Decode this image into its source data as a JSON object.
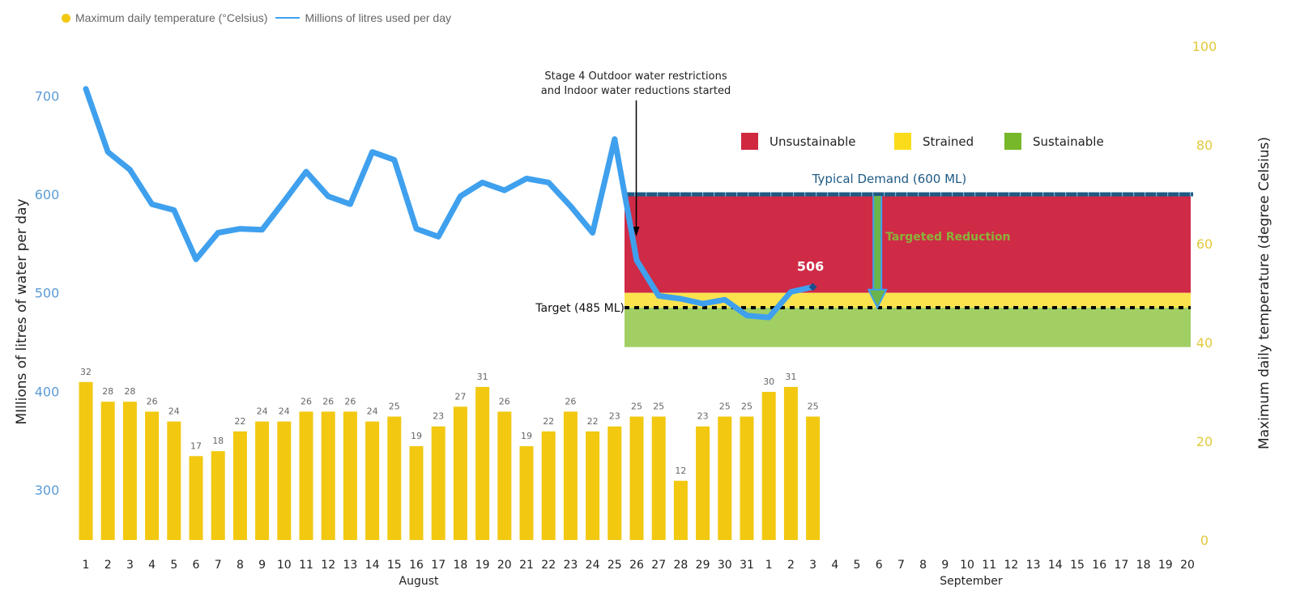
{
  "legend": {
    "temp_label": "Maximum daily temperature (°Celsius)",
    "usage_label": "Millions of litres used per day",
    "temp_color": "#F2C811",
    "usage_color": "#3FA0EE"
  },
  "annotations": {
    "stage4_line1": "Stage 4 Outdoor water restrictions",
    "stage4_line2": "and Indoor water reductions started",
    "typical_demand": "Typical Demand (600 ML)",
    "target": "Target (485 ML)",
    "targeted_reduction": "Targeted Reduction",
    "last_value": "506"
  },
  "zone_legend": [
    {
      "label": "Unsustainable",
      "color": "#D0283F"
    },
    {
      "label": "Strained",
      "color": "#FADC1C"
    },
    {
      "label": "Sustainable",
      "color": "#76B82A"
    }
  ],
  "chart_data": {
    "type": "bar+line",
    "title": "",
    "xlabel_groups": [
      "August",
      "September"
    ],
    "categories": [
      "1",
      "2",
      "3",
      "4",
      "5",
      "6",
      "7",
      "8",
      "9",
      "10",
      "11",
      "12",
      "13",
      "14",
      "15",
      "16",
      "17",
      "18",
      "19",
      "20",
      "21",
      "22",
      "23",
      "24",
      "25",
      "26",
      "27",
      "28",
      "29",
      "30",
      "31",
      "1",
      "2",
      "3",
      "4",
      "5",
      "6",
      "7",
      "8",
      "9",
      "10",
      "11",
      "12",
      "13",
      "14",
      "15",
      "16",
      "17",
      "18",
      "19",
      "20"
    ],
    "category_months": [
      "August",
      "August",
      "August",
      "August",
      "August",
      "August",
      "August",
      "August",
      "August",
      "August",
      "August",
      "August",
      "August",
      "August",
      "August",
      "August",
      "August",
      "August",
      "August",
      "August",
      "August",
      "August",
      "August",
      "August",
      "August",
      "August",
      "August",
      "August",
      "August",
      "August",
      "August",
      "September",
      "September",
      "September",
      "September",
      "September",
      "September",
      "September",
      "September",
      "September",
      "September",
      "September",
      "September",
      "September",
      "September",
      "September",
      "September",
      "September",
      "September",
      "September",
      "September"
    ],
    "ylabel_left": "MIllions of litres of water per day",
    "ylabel_right": "Maximum daily temperature (degree Celsius)",
    "ylim_left": [
      250,
      720
    ],
    "yticks_left": [
      300,
      400,
      500,
      600,
      700
    ],
    "ylim_right": [
      0,
      100
    ],
    "yticks_right": [
      0,
      20,
      40,
      60,
      80,
      100
    ],
    "grid": false,
    "legend_position": "top-left",
    "series": [
      {
        "name": "Maximum daily temperature (°Celsius)",
        "type": "bar",
        "axis": "right",
        "values": [
          32,
          28,
          28,
          26,
          24,
          17,
          18,
          22,
          24,
          24,
          26,
          26,
          26,
          24,
          25,
          19,
          23,
          27,
          31,
          26,
          19,
          22,
          26,
          22,
          23,
          25,
          25,
          12,
          23,
          25,
          25,
          30,
          31,
          25
        ]
      },
      {
        "name": "Millions of litres used per day",
        "type": "line",
        "axis": "left",
        "values": [
          707,
          643,
          625,
          590,
          584,
          534,
          561,
          565,
          564,
          593,
          623,
          598,
          590,
          643,
          635,
          565,
          557,
          598,
          612,
          604,
          616,
          612,
          588,
          561,
          656,
          533,
          497,
          494,
          489,
          493,
          477,
          475,
          501,
          506
        ]
      }
    ],
    "zones": [
      {
        "name": "Unsustainable",
        "from": 500,
        "to": 600,
        "start_index": 25
      },
      {
        "name": "Strained",
        "from": 485,
        "to": 500,
        "start_index": 25
      },
      {
        "name": "Sustainable",
        "from": 445,
        "to": 485,
        "start_index": 25
      }
    ],
    "reference_lines": [
      {
        "name": "Typical Demand",
        "value": 600
      },
      {
        "name": "Target",
        "value": 485
      }
    ],
    "event_index": 25,
    "reduction_arrow_index": 36
  }
}
